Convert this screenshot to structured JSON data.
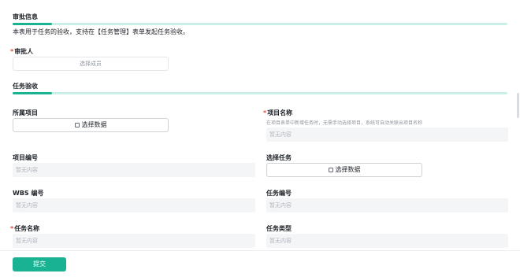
{
  "approval_info": {
    "title": "审批信息",
    "description": "本表用于任务的验收，支持在【任务管理】表单发起任务验收。",
    "approver_label": "审批人",
    "approver_placeholder": "选择成员"
  },
  "task_acceptance": {
    "title": "任务验收",
    "project_label": "所属项目",
    "project_button": "选择数据",
    "project_name_label": "项目名称",
    "project_name_hint": "在项目表单中新增任务时，无需手动选择项目，系统可自动关联出项目名称",
    "project_name_value": "暂无内容",
    "project_code_label": "项目编号",
    "project_code_value": "暂无内容",
    "select_task_label": "选择任务",
    "select_task_button": "选择数据",
    "wbs_label": "WBS 编号",
    "wbs_value": "暂无内容",
    "task_code_label": "任务编号",
    "task_code_value": "暂无内容",
    "task_name_label": "任务名称",
    "task_name_value": "暂无内容",
    "task_type_label": "任务类型",
    "task_type_value": "暂无内容"
  },
  "footer": {
    "submit_label": "提交"
  },
  "colors": {
    "accent": "#19b394",
    "accent_light": "#c9efe6",
    "required": "#e5493a"
  },
  "icons": {
    "select_data": "database-icon"
  }
}
